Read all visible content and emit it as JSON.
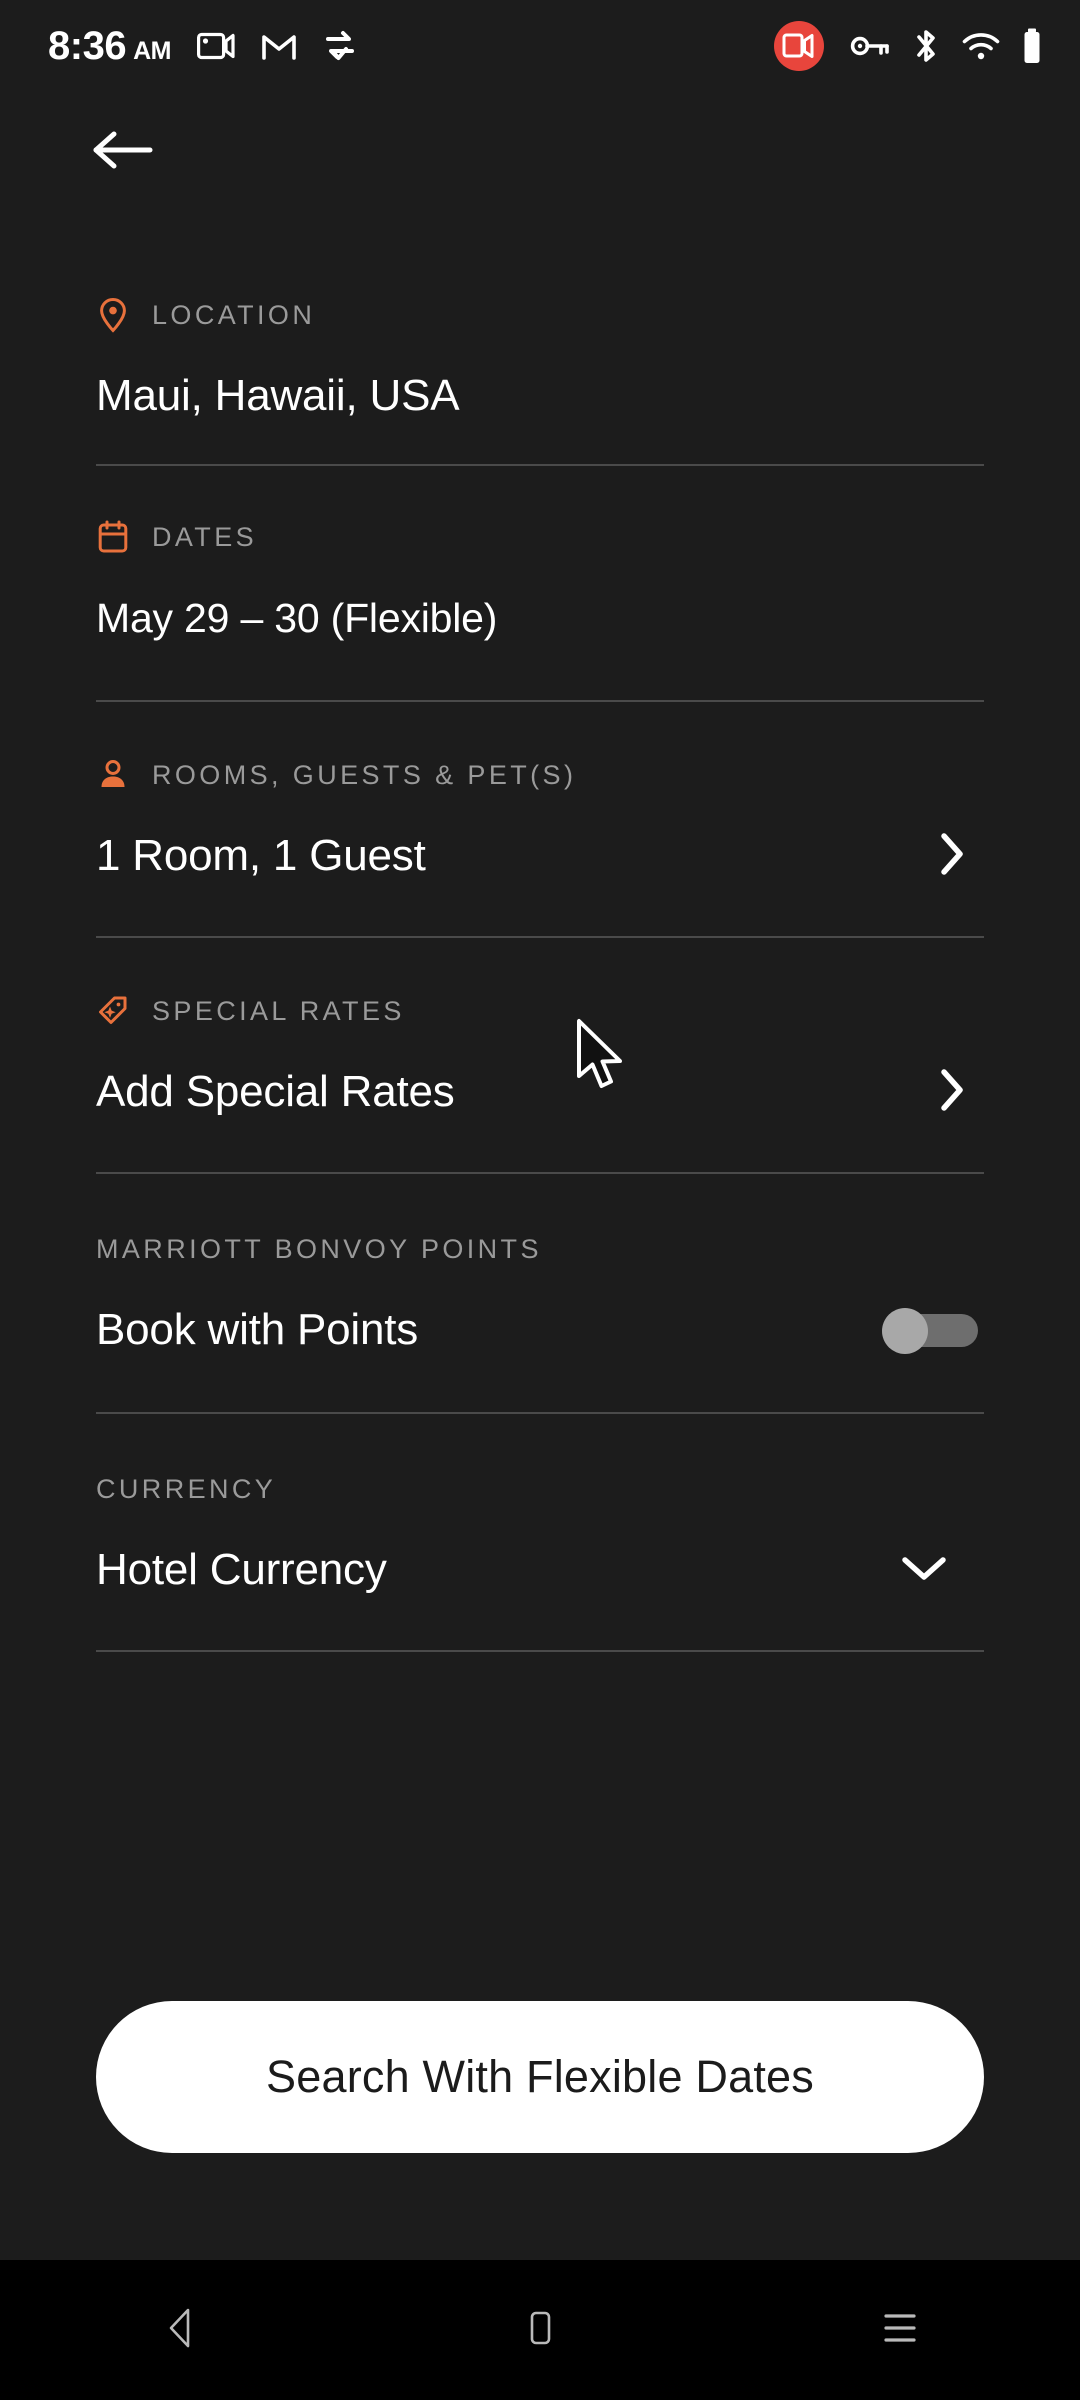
{
  "statusbar": {
    "time": "8:36",
    "ampm": "AM",
    "left_icons": [
      "screen-record-icon",
      "gmail-icon",
      "data-transfer-icon"
    ],
    "right_icons": [
      "screen-record-active-icon",
      "vpn-key-icon",
      "bluetooth-icon",
      "wifi-icon",
      "battery-icon"
    ],
    "record_badge_color": "#E8453C"
  },
  "nav": {
    "back_label": "Back"
  },
  "theme": {
    "background": "#1C1C1C",
    "accent": "#E8713C",
    "caption": "#9A9A9A",
    "value": "#FFFFFF",
    "divider": "#4A4A4A",
    "cta_bg": "#FFFFFF",
    "cta_text": "#1B1B1B"
  },
  "sections": [
    {
      "id": "location",
      "icon": "map-pin-icon",
      "caption": "LOCATION",
      "value": "Maui, Hawaii, USA",
      "accessory": "none"
    },
    {
      "id": "dates",
      "icon": "calendar-icon",
      "caption": "DATES",
      "value": "May 29 – 30 (Flexible)",
      "accessory": "none"
    },
    {
      "id": "rooms-guests-pets",
      "icon": "person-icon",
      "caption": "ROOMS, GUESTS & PET(S)",
      "value": "1 Room, 1 Guest",
      "accessory": "chevron-right"
    },
    {
      "id": "special-rates",
      "icon": "tag-sparkle-icon",
      "caption": "SPECIAL RATES",
      "value": "Add Special Rates",
      "accessory": "chevron-right"
    },
    {
      "id": "marriott-bonvoy-points",
      "icon": "none",
      "caption": "MARRIOTT BONVOY POINTS",
      "value": "Book with Points",
      "accessory": "toggle",
      "toggle_state": "off"
    },
    {
      "id": "currency",
      "icon": "none",
      "caption": "CURRENCY",
      "value": "Hotel Currency",
      "accessory": "chevron-down"
    }
  ],
  "cta": {
    "label": "Search With Flexible Dates"
  },
  "system_nav": {
    "back": "back-triangle-icon",
    "home": "home-rect-icon",
    "recents": "recents-lines-icon"
  }
}
